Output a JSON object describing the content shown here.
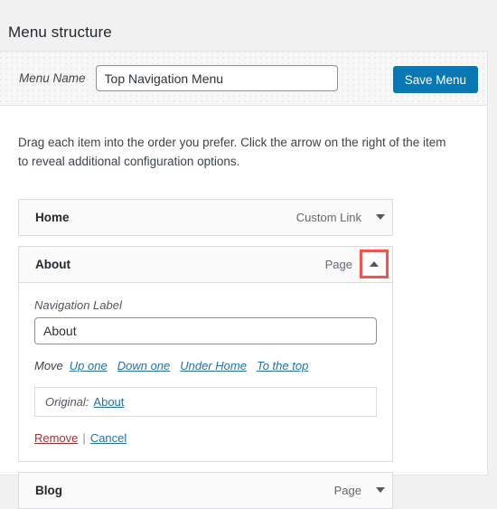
{
  "page": {
    "title": "Menu structure"
  },
  "menu_header": {
    "name_label": "Menu Name",
    "name_value": "Top Navigation Menu",
    "name_placeholder": "Menu Name",
    "save_label": "Save Menu",
    "save_color": "#0878b4"
  },
  "instructions": "Drag each item into the order you prefer. Click the arrow on the right of the item to reveal additional configuration options.",
  "menu_items": [
    {
      "title": "Home",
      "type": "Custom Link",
      "expanded": false,
      "toggle_icon": "chevron-down-icon",
      "highlighted": false
    },
    {
      "title": "About",
      "type": "Page",
      "expanded": true,
      "toggle_icon": "chevron-up-icon",
      "highlighted": true,
      "highlight_color": "#f4544c",
      "settings": {
        "nav_label_caption": "Navigation Label",
        "nav_label_value": "About",
        "move_caption": "Move",
        "move_links": [
          "Up one",
          "Down one",
          "Under Home",
          "To the top"
        ],
        "original_caption": "Original:",
        "original_value": "About",
        "remove_label": "Remove",
        "separator": "|",
        "cancel_label": "Cancel",
        "remove_color": "#b32d2e",
        "link_color": "#2271b1"
      }
    },
    {
      "title": "Blog",
      "type": "Page",
      "expanded": false,
      "toggle_icon": "chevron-down-icon",
      "highlighted": false
    }
  ]
}
